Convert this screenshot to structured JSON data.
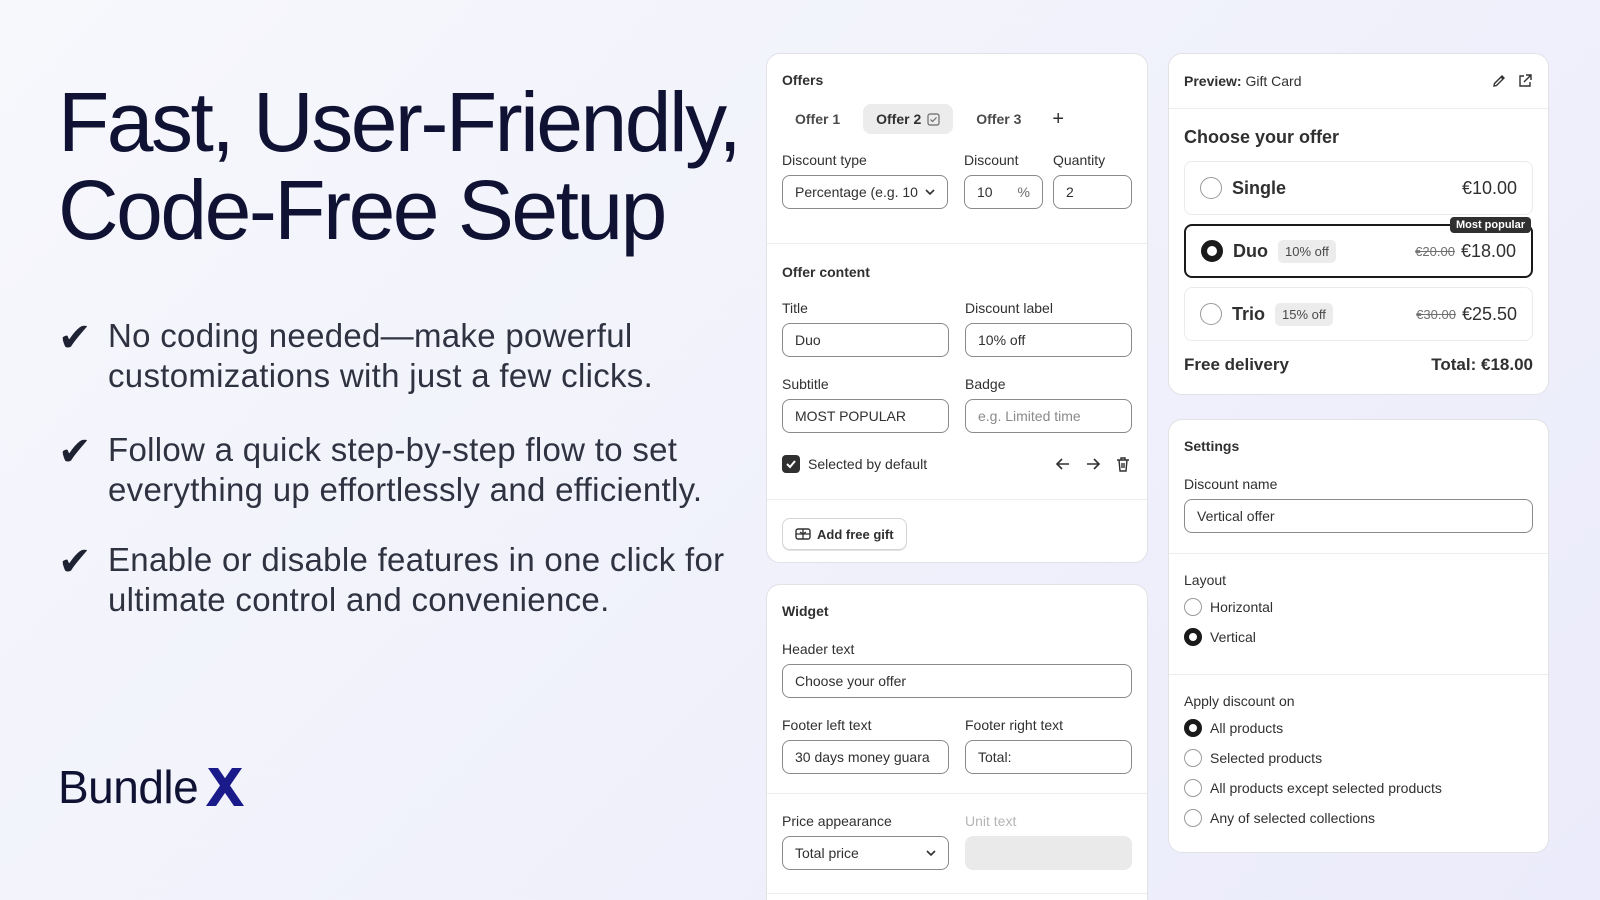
{
  "hero": {
    "title_line1": "Fast, User-Friendly,",
    "title_line2": "Code-Free Setup",
    "features": [
      {
        "check": "✔",
        "line1": "No coding needed—make powerful",
        "line2": "customizations with just a few clicks."
      },
      {
        "check": "✔",
        "line1": "Follow a quick step-by-step flow to set",
        "line2": "everything up effortlessly and efficiently."
      },
      {
        "check": "✔",
        "line1": "Enable or disable features in one click for",
        "line2": "ultimate control and convenience."
      }
    ],
    "brand": "Bundle",
    "brand_color": "#1b1a8a"
  },
  "offers": {
    "heading": "Offers",
    "tabs": [
      "Offer 1",
      "Offer 2",
      "Offer 3"
    ],
    "active_tab": "Offer 2",
    "add_symbol": "+",
    "discount_type_label": "Discount type",
    "discount_type_value": "Percentage (e.g. 10",
    "discount_label": "Discount",
    "discount_value": "10",
    "discount_unit": "%",
    "quantity_label": "Quantity",
    "quantity_value": "2",
    "content_heading": "Offer content",
    "title_label": "Title",
    "title_value": "Duo",
    "discount_label_label": "Discount label",
    "discount_label_value": "10% off",
    "subtitle_label": "Subtitle",
    "subtitle_value": "MOST POPULAR",
    "badge_label": "Badge",
    "badge_placeholder": "e.g. Limited time",
    "selected_default_label": "Selected by default",
    "selected_default": true,
    "add_gift_label": "Add free gift"
  },
  "widget": {
    "heading": "Widget",
    "header_text_label": "Header text",
    "header_text_value": "Choose your offer",
    "footer_left_label": "Footer left text",
    "footer_left_value": "30 days money guara",
    "footer_right_label": "Footer right text",
    "footer_right_value": "Total:",
    "price_appearance_label": "Price appearance",
    "price_appearance_value": "Total price",
    "unit_text_label": "Unit text",
    "unit_text_value": ""
  },
  "preview": {
    "label": "Preview:",
    "name": "Gift Card",
    "header": "Choose your offer",
    "options": [
      {
        "name": "Single",
        "pill": "",
        "old": "",
        "price": "€10.00",
        "selected": false,
        "badge": ""
      },
      {
        "name": "Duo",
        "pill": "10% off",
        "old": "€20.00",
        "price": "€18.00",
        "selected": true,
        "badge": "Most popular"
      },
      {
        "name": "Trio",
        "pill": "15% off",
        "old": "€30.00",
        "price": "€25.50",
        "selected": false,
        "badge": ""
      }
    ],
    "footer_left": "Free delivery",
    "footer_right": "Total: €18.00"
  },
  "settings": {
    "heading": "Settings",
    "discount_name_label": "Discount name",
    "discount_name_value": "Vertical offer",
    "layout_label": "Layout",
    "layout_options": [
      "Horizontal",
      "Vertical"
    ],
    "layout_selected": "Vertical",
    "apply_label": "Apply discount on",
    "apply_options": [
      "All products",
      "Selected products",
      "All products except selected products",
      "Any of selected collections"
    ],
    "apply_selected": "All products"
  }
}
